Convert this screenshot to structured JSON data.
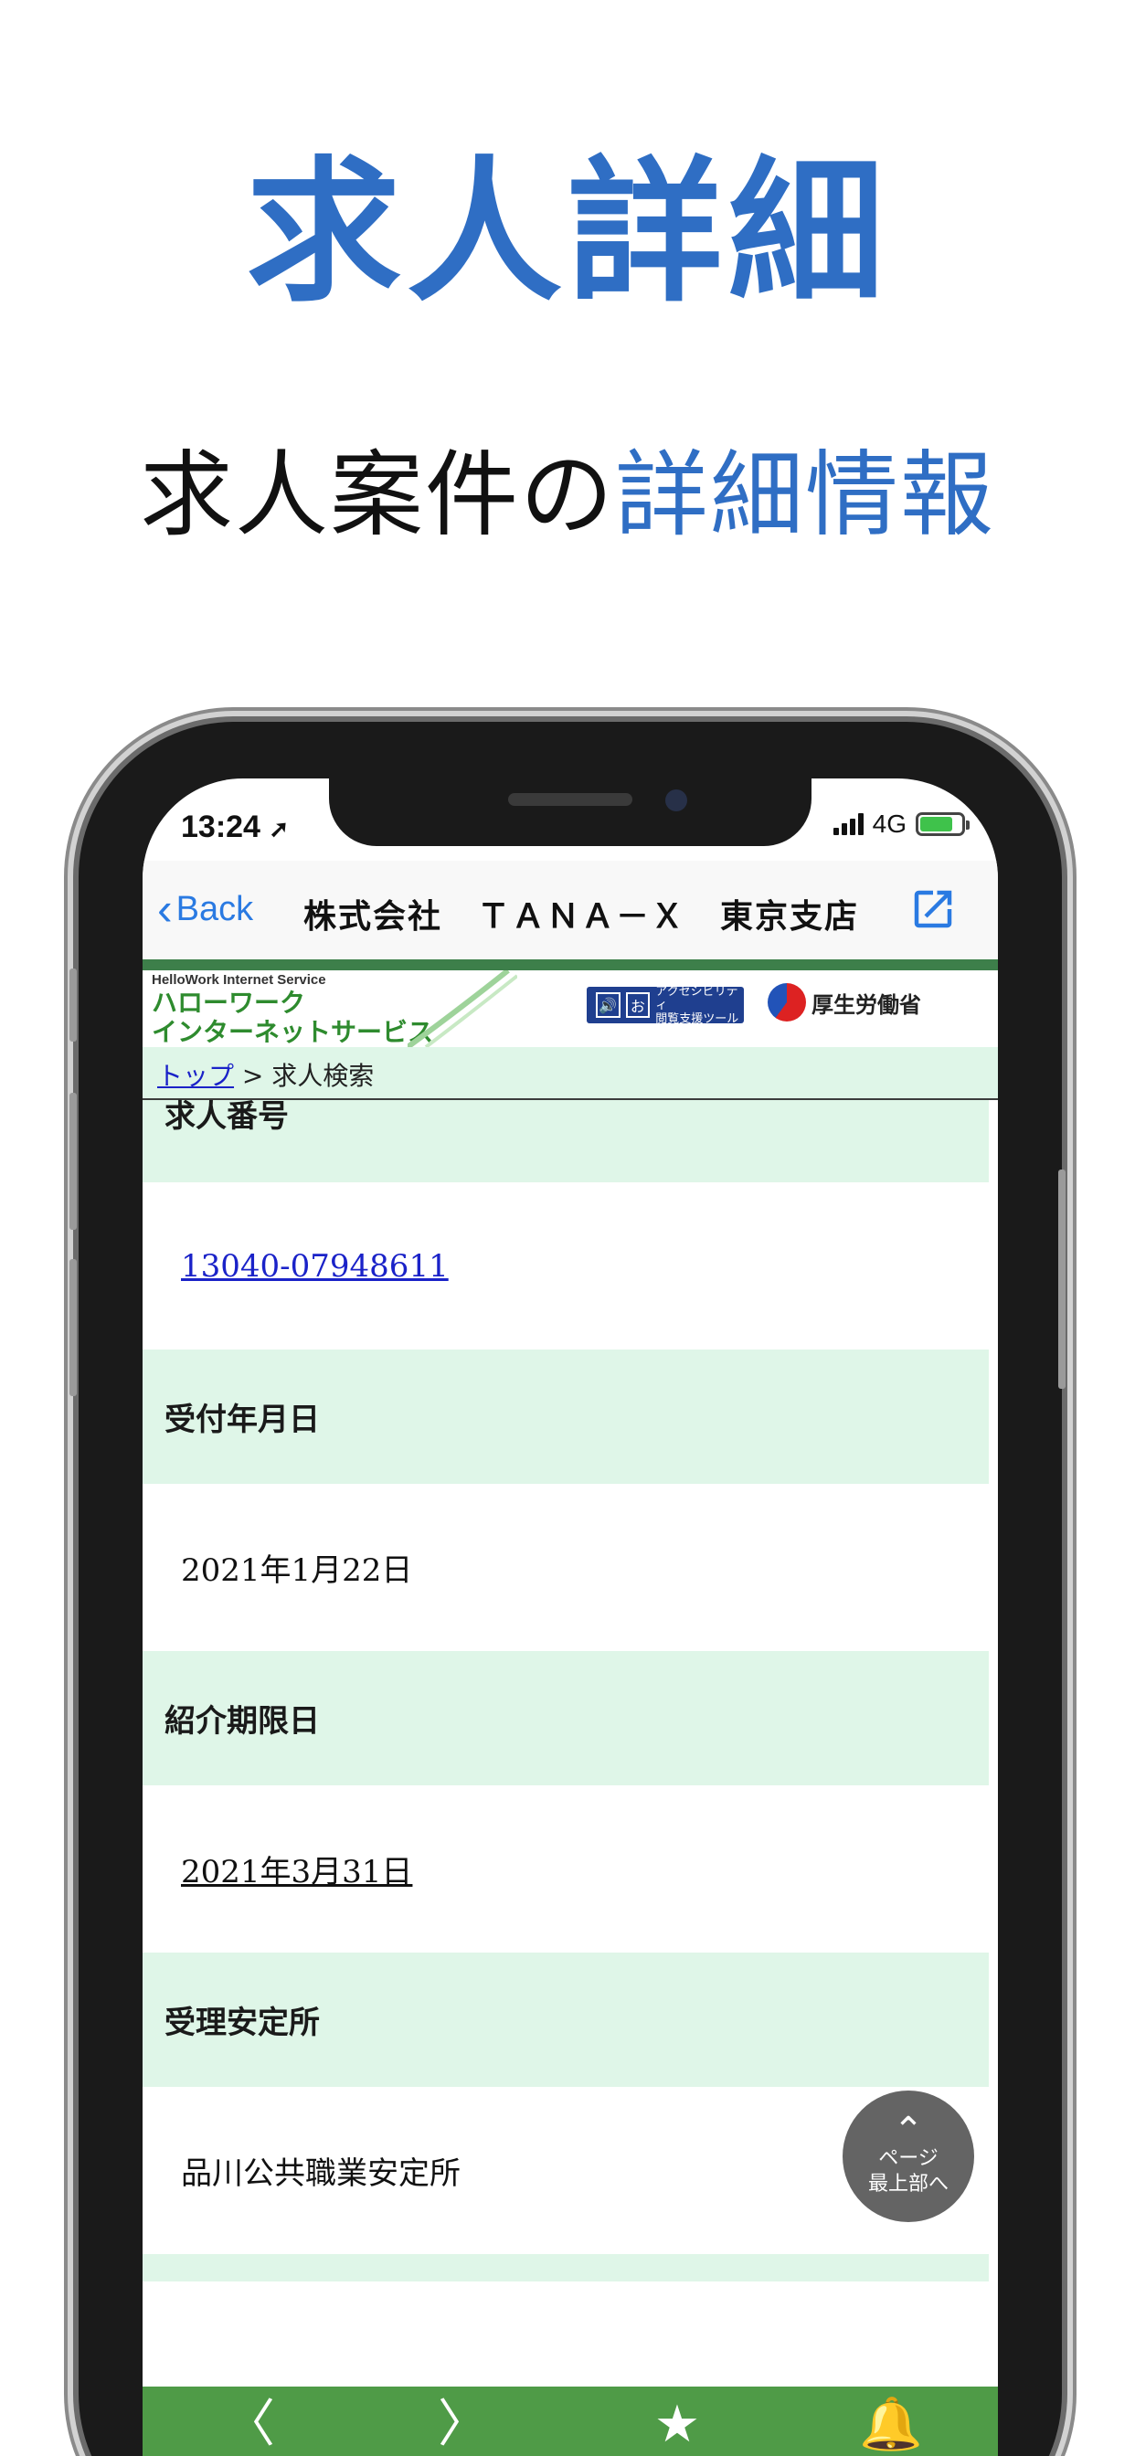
{
  "marketing": {
    "headline": "求人詳細",
    "subhead_plain": "求人案件の",
    "subhead_accent": "詳細情報",
    "accent_color": "#2f6ec4"
  },
  "status_bar": {
    "time": "13:24",
    "location_icon": "location-arrow-icon",
    "network": "4G"
  },
  "nav_bar": {
    "back_label": "Back",
    "title": "株式会社　ＴＡＮＡ－Ｘ　東京支店",
    "external_icon": "external-link-icon"
  },
  "site_header": {
    "small_text": "HelloWork Internet Service",
    "logo_line1": "ハローワーク",
    "logo_line2": "インターネットサービス",
    "accessibility_line1": "アクセシビリティ",
    "accessibility_line2": "閲覧支援ツール",
    "ministry": "厚生労働省"
  },
  "breadcrumb": {
    "top_link": "トップ",
    "separator": " > ",
    "current": "求人検索"
  },
  "fields": {
    "job_number_label": "求人番号",
    "job_number_value": "13040-07948611",
    "received_label": "受付年月日",
    "received_value": "2021年1月22日",
    "deadline_label": "紹介期限日",
    "deadline_value": "2021年3月31日",
    "office_label": "受理安定所",
    "office_value": "品川公共職業安定所"
  },
  "scroll_top": {
    "line1": "ページ",
    "line2": "最上部へ"
  },
  "toolbar": {
    "back_glyph": "〈",
    "forward_glyph": "〉",
    "bookmark_glyph": "★",
    "notify_glyph": "🔔",
    "color": "#4f9b47"
  }
}
